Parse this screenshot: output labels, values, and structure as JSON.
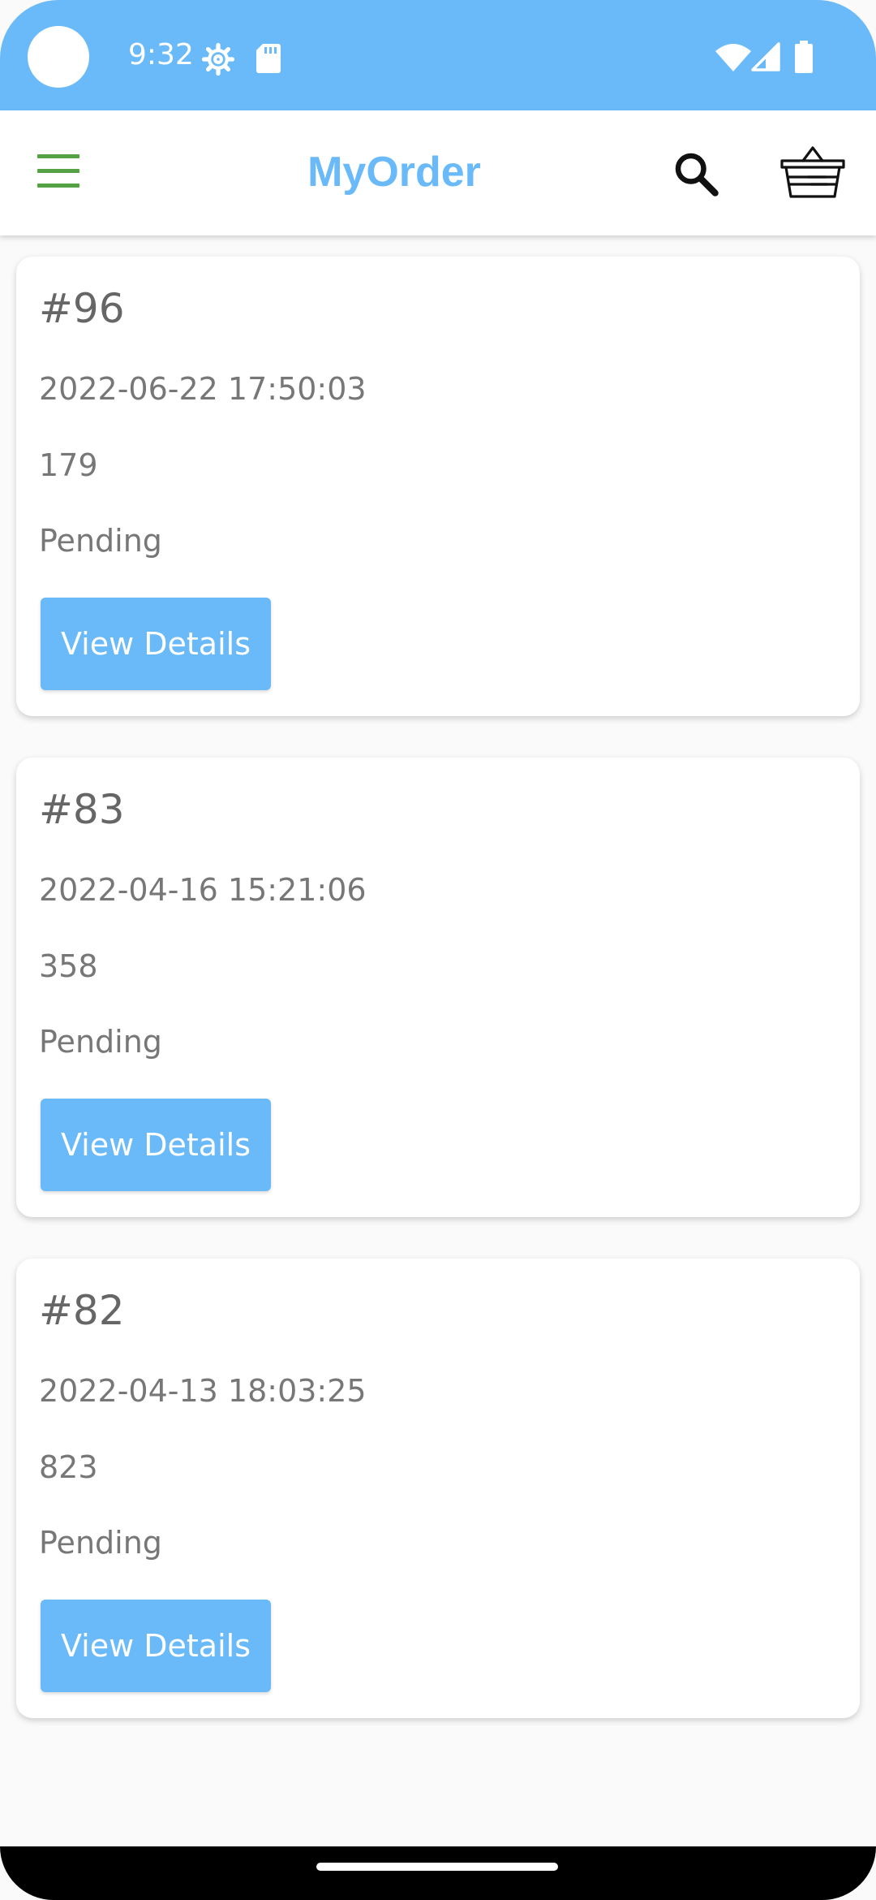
{
  "status_bar": {
    "time": "9:32",
    "icons": [
      "settings-gear-icon",
      "sd-card-icon",
      "wifi-icon",
      "signal-icon",
      "battery-icon"
    ]
  },
  "app_bar": {
    "title": "MyOrder",
    "menu_icon": "hamburger-menu-icon",
    "search_icon": "search-icon",
    "cart_icon": "basket-icon"
  },
  "colors": {
    "accent": "#6abaf9",
    "menu_icon": "#55a244",
    "text": "#777777",
    "background": "#fafafa"
  },
  "orders": [
    {
      "number": "#96",
      "date": "2022-06-22 17:50:03",
      "amount": "179",
      "status": "Pending",
      "button_label": "View Details"
    },
    {
      "number": "#83",
      "date": "2022-04-16 15:21:06",
      "amount": "358",
      "status": "Pending",
      "button_label": "View Details"
    },
    {
      "number": "#82",
      "date": "2022-04-13 18:03:25",
      "amount": "823",
      "status": "Pending",
      "button_label": "View Details"
    }
  ]
}
